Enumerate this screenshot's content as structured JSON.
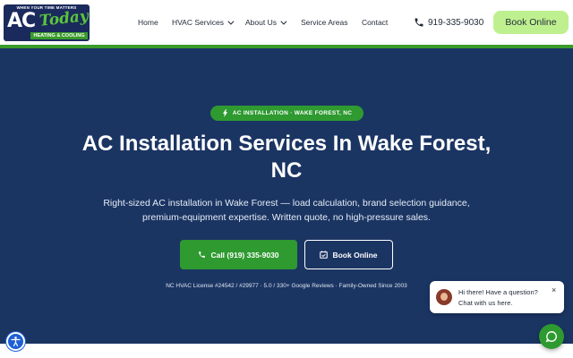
{
  "logo": {
    "tagline": "WHEN YOUR TIME MATTERS",
    "ac": "AC",
    "today": "Today",
    "sub": "HEATING & COOLING"
  },
  "nav": {
    "home": "Home",
    "hvac": "HVAC Services",
    "about": "About Us",
    "areas": "Service Areas",
    "contact": "Contact"
  },
  "header": {
    "phone": "919-335-9030",
    "book_label": "Book Online"
  },
  "hero": {
    "badge": "AC INSTALLATION · WAKE FOREST, NC",
    "title_line1": "AC Installation Services In Wake Forest,",
    "title_line2": "NC",
    "desc_line1": "Right-sized AC installation in Wake Forest — load calculation, brand selection guidance,",
    "desc_line2": "premium-equipment expertise. Written quote, no high-pressure sales.",
    "call_label": "Call (919) 335-9030",
    "book_label": "Book Online",
    "trust": "NC HVAC License #24542 / #29977  ·  5.0 / 330+ Google Reviews  ·  Family-Owned Since 2003"
  },
  "chat": {
    "line1": "Hi there! Have a question?",
    "line2": "Chat with us here.",
    "close": "×"
  },
  "colors": {
    "navy": "#1b3563",
    "green": "#2e9a30",
    "lime": "#bff08f",
    "accessibility_blue": "#1e5fd6"
  }
}
